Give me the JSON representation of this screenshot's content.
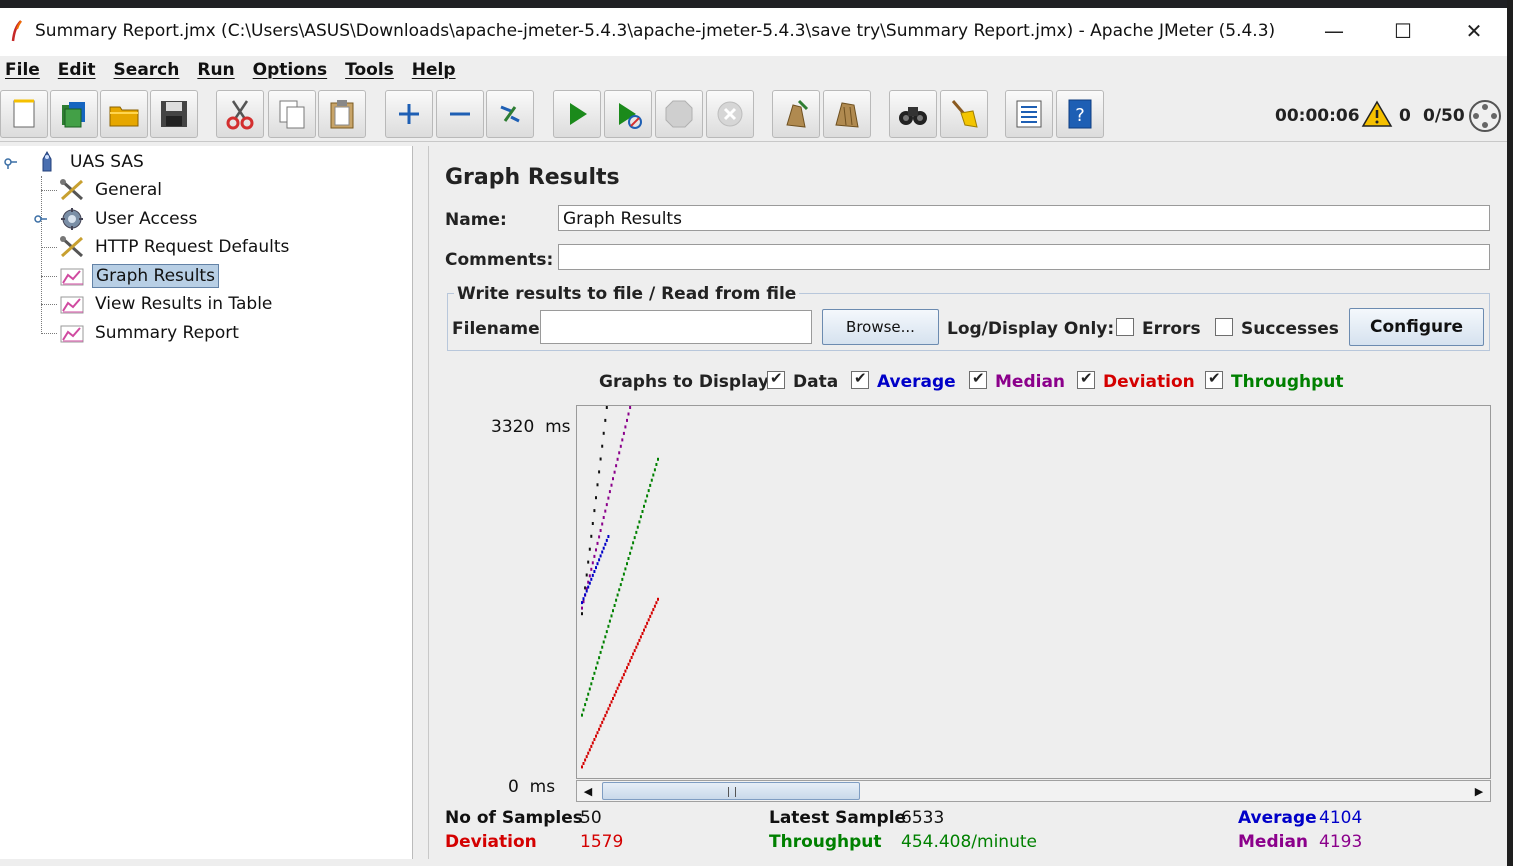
{
  "window": {
    "title": "Summary Report.jmx (C:\\Users\\ASUS\\Downloads\\apache-jmeter-5.4.3\\apache-jmeter-5.4.3\\save try\\Summary Report.jmx) - Apache JMeter (5.4.3)",
    "minimize_glyph": "—",
    "maximize_glyph": "☐",
    "close_glyph": "✕"
  },
  "menu": [
    "File",
    "Edit",
    "Search",
    "Run",
    "Options",
    "Tools",
    "Help"
  ],
  "toolbar": {
    "buttons": [
      {
        "name": "new-icon"
      },
      {
        "name": "templates-icon"
      },
      {
        "name": "open-icon"
      },
      {
        "name": "save-icon"
      },
      {
        "name": "cut-icon"
      },
      {
        "name": "copy-icon"
      },
      {
        "name": "paste-icon"
      },
      {
        "name": "expand-icon"
      },
      {
        "name": "collapse-icon"
      },
      {
        "name": "toggle-icon"
      },
      {
        "name": "start-icon"
      },
      {
        "name": "start-no-pauses-icon"
      },
      {
        "name": "stop-icon"
      },
      {
        "name": "shutdown-icon"
      },
      {
        "name": "clear-icon"
      },
      {
        "name": "clear-all-icon"
      },
      {
        "name": "search-icon"
      },
      {
        "name": "reset-search-icon"
      },
      {
        "name": "function-helper-icon"
      },
      {
        "name": "help-icon"
      }
    ],
    "timer": "00:00:06",
    "warnings": "0",
    "threads": "0/50"
  },
  "tree": {
    "root": "UAS SAS",
    "items": [
      {
        "label": "General",
        "icon": "config-icon"
      },
      {
        "label": "User Access",
        "icon": "thread-group-icon"
      },
      {
        "label": "HTTP Request Defaults",
        "icon": "config-icon"
      },
      {
        "label": "Graph Results",
        "icon": "listener-icon",
        "selected": true
      },
      {
        "label": "View Results in Table",
        "icon": "listener-icon"
      },
      {
        "label": "Summary Report",
        "icon": "listener-icon"
      }
    ]
  },
  "panel": {
    "title": "Graph Results",
    "name_label": "Name:",
    "name_value": "Graph Results",
    "comments_label": "Comments:",
    "comments_value": "",
    "file_group_title": "Write results to file / Read from file",
    "filename_label": "Filename",
    "filename_value": "",
    "browse_label": "Browse...",
    "log_display_label": "Log/Display Only:",
    "errors_label": "Errors",
    "successes_label": "Successes",
    "configure_label": "Configure",
    "graphs_label": "Graphs to Display",
    "graph_options": [
      {
        "label": "Data",
        "checked": true,
        "color": "#111111"
      },
      {
        "label": "Average",
        "checked": true,
        "color": "#0000c8"
      },
      {
        "label": "Median",
        "checked": true,
        "color": "#8b008b"
      },
      {
        "label": "Deviation",
        "checked": true,
        "color": "#d40000"
      },
      {
        "label": "Throughput",
        "checked": true,
        "color": "#008000"
      }
    ]
  },
  "chart_data": {
    "type": "scatter",
    "y_max_label": "3320",
    "y_min_label": "0",
    "y_unit": "ms",
    "ylim": [
      0,
      3320
    ],
    "x_samples": 50,
    "series": [
      {
        "key": "data",
        "color": "#111111",
        "start": [
          1,
          1450
        ],
        "end": [
          17,
          3320
        ]
      },
      {
        "key": "median",
        "color": "#8b008b",
        "start": [
          1,
          1500
        ],
        "end": [
          32,
          3320
        ]
      },
      {
        "key": "average",
        "color": "#0000c8",
        "start": [
          1,
          1550
        ],
        "end": [
          18,
          2150
        ]
      },
      {
        "key": "throughput",
        "color": "#008000",
        "start": [
          1,
          530
        ],
        "end": [
          50,
          2850
        ]
      },
      {
        "key": "deviation",
        "color": "#d40000",
        "start": [
          1,
          60
        ],
        "end": [
          50,
          1580
        ]
      }
    ]
  },
  "stats": {
    "samples_label": "No of Samples",
    "samples_value": "50",
    "latest_label": "Latest Sample",
    "latest_value": "6533",
    "average_label": "Average",
    "average_value": "4104",
    "deviation_label": "Deviation",
    "deviation_value": "1579",
    "throughput_label": "Throughput",
    "throughput_value": "454.408/minute",
    "median_label": "Median",
    "median_value": "4193"
  }
}
